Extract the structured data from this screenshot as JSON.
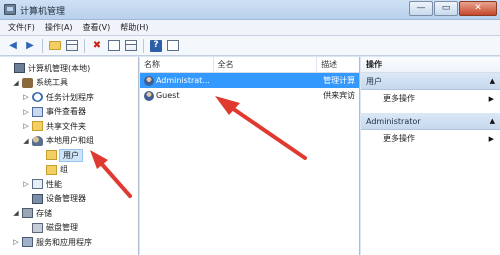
{
  "window": {
    "title": "计算机管理",
    "minimize": "—",
    "maximize": "▭",
    "close": "✕"
  },
  "menu": [
    "文件(F)",
    "操作(A)",
    "查看(V)",
    "帮助(H)"
  ],
  "toolbar": {
    "icons": [
      "back-icon",
      "forward-icon",
      "up-folder-icon",
      "show-hide-tree-icon",
      "delete-icon",
      "properties-icon",
      "export-icon",
      "help-icon",
      "view-icon"
    ],
    "back": "◀",
    "forward": "▶",
    "delete": "✖",
    "help": "?"
  },
  "tree": [
    {
      "label": "计算机管理(本地)",
      "expander": "",
      "icon": "computer-icon"
    },
    {
      "label": "系统工具",
      "expander": "◢",
      "icon": "tools-icon"
    },
    {
      "label": "任务计划程序",
      "expander": "▷",
      "icon": "clock-icon"
    },
    {
      "label": "事件查看器",
      "expander": "▷",
      "icon": "event-viewer-icon"
    },
    {
      "label": "共享文件夹",
      "expander": "▷",
      "icon": "shared-folder-icon"
    },
    {
      "label": "本地用户和组",
      "expander": "◢",
      "icon": "users-groups-icon"
    },
    {
      "label": "用户",
      "expander": "",
      "icon": "folder-icon",
      "selected": true
    },
    {
      "label": "组",
      "expander": "",
      "icon": "folder-icon"
    },
    {
      "label": "性能",
      "expander": "▷",
      "icon": "performance-icon"
    },
    {
      "label": "设备管理器",
      "expander": "",
      "icon": "device-manager-icon"
    },
    {
      "label": "存储",
      "expander": "◢",
      "icon": "storage-icon"
    },
    {
      "label": "磁盘管理",
      "expander": "",
      "icon": "disk-icon"
    },
    {
      "label": "服务和应用程序",
      "expander": "▷",
      "icon": "services-icon"
    }
  ],
  "list": {
    "columns": [
      "名称",
      "全名",
      "描述"
    ],
    "rows": [
      {
        "name": "Administrat...",
        "fullname": "",
        "desc": "管理计算",
        "selected": true
      },
      {
        "name": "Guest",
        "fullname": "",
        "desc": "供来宾访",
        "selected": false
      }
    ]
  },
  "actions": {
    "header": "操作",
    "groups": [
      {
        "title": "用户",
        "items": [
          "更多操作"
        ]
      },
      {
        "title": "Administrator",
        "items": [
          "更多操作"
        ]
      }
    ]
  },
  "colors": {
    "selection": "#3399ff",
    "arrow": "#e0392f"
  }
}
